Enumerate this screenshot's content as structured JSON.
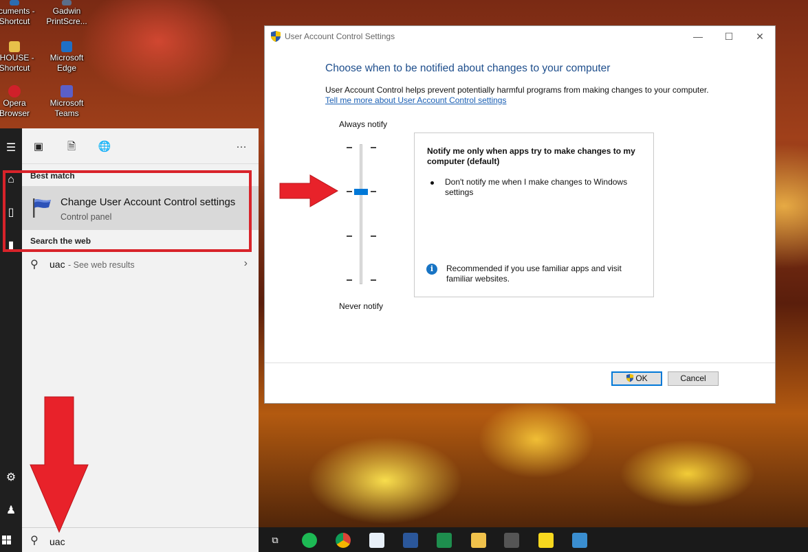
{
  "desktop": {
    "icons": [
      {
        "line1": "ocuments -",
        "line2": "Shortcut",
        "glyph": "document-icon"
      },
      {
        "line1": "Gadwin",
        "line2": "PrintScre...",
        "glyph": "camera-icon"
      },
      {
        "line1": "I-HOUSE -",
        "line2": "Shortcut",
        "glyph": "folder-icon"
      },
      {
        "line1": "Microsoft",
        "line2": "Edge",
        "glyph": "edge-icon"
      },
      {
        "line1": "Opera",
        "line2": "Browser",
        "glyph": "opera-icon"
      },
      {
        "line1": "Microsoft",
        "line2": "Teams",
        "glyph": "teams-icon"
      }
    ]
  },
  "start_menu": {
    "best_match_header": "Best match",
    "best_match": {
      "title": "Change User Account Control settings",
      "subtitle": "Control panel"
    },
    "search_web_header": "Search the web",
    "web_result": {
      "query": "uac",
      "suffix": " - See web results"
    },
    "search_text": "uac",
    "toolbar_more": "···"
  },
  "dialog": {
    "title": "User Account Control Settings",
    "heading": "Choose when to be notified about changes to your computer",
    "description": "User Account Control helps prevent potentially harmful programs from making changes to your computer.",
    "link": "Tell me more about User Account Control settings",
    "always_label": "Always notify",
    "never_label": "Never notify",
    "slider_level": 3,
    "slider_levels": 4,
    "info_title": "Notify me only when apps try to make changes to my computer (default)",
    "info_bullet": "Don't notify me when I make changes to Windows settings",
    "info_recommend": "Recommended if you use familiar apps and visit familiar websites.",
    "ok_label": "OK",
    "cancel_label": "Cancel",
    "accent": "#0078d7"
  },
  "annotations": {
    "color": "#d8232a"
  }
}
